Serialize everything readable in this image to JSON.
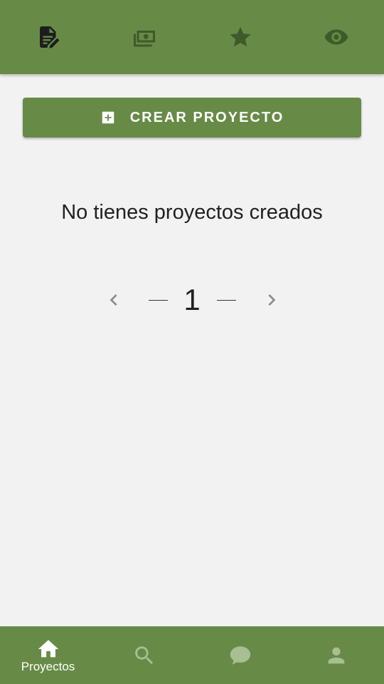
{
  "top_tabs": [
    {
      "name": "edit-document",
      "icon": "edit-document-icon",
      "active": true
    },
    {
      "name": "money",
      "icon": "money-icon",
      "active": false
    },
    {
      "name": "favorites",
      "icon": "star-icon",
      "active": false
    },
    {
      "name": "watching",
      "icon": "eye-icon",
      "active": false
    }
  ],
  "create_button": {
    "label": "CREAR PROYECTO",
    "icon": "plus-box-icon"
  },
  "empty_message": "No tienes proyectos creados",
  "pagination": {
    "current_page": "1"
  },
  "bottom_nav": [
    {
      "label": "Proyectos",
      "icon": "home-icon",
      "active": true
    },
    {
      "label": "",
      "icon": "search-icon",
      "active": false
    },
    {
      "label": "",
      "icon": "chat-icon",
      "active": false
    },
    {
      "label": "",
      "icon": "user-icon",
      "active": false
    }
  ],
  "colors": {
    "primary": "#678b46",
    "background": "#f2f2f2",
    "text": "#212121"
  }
}
